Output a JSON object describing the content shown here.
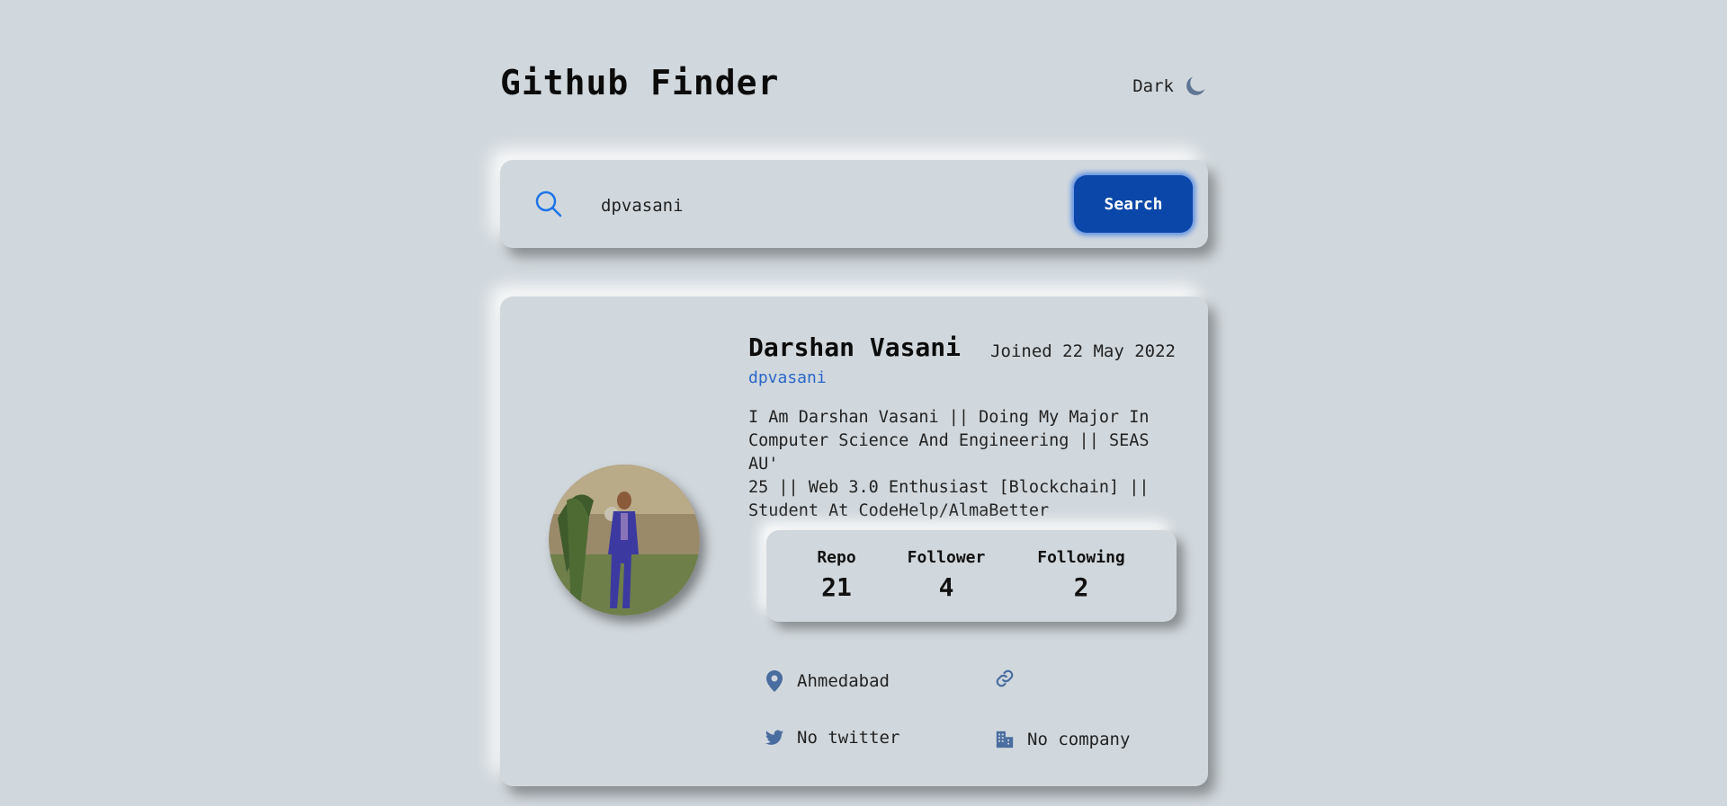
{
  "header": {
    "title": "Github Finder",
    "mode_label": "Dark",
    "mode_icon": "moon-icon"
  },
  "search": {
    "icon": "search-icon",
    "value": "dpvasani",
    "button_label": "Search"
  },
  "profile": {
    "name": "Darshan Vasani",
    "joined": "Joined 22 May 2022",
    "login": "dpvasani",
    "bio": "I Am Darshan Vasani || Doing My Major In\nComputer Science And Engineering || SEAS AU'\n25 || Web 3.0 Enthusiast [Blockchain] ||\nStudent At CodeHelp/AlmaBetter",
    "stats": {
      "repo_label": "Repo",
      "repo": "21",
      "follower_label": "Follower",
      "follower": "4",
      "following_label": "Following",
      "following": "2"
    },
    "links": {
      "location": "Ahmedabad",
      "website": "",
      "twitter": "No twitter",
      "company": "No company"
    }
  },
  "colors": {
    "background": "#d1d8dd",
    "accent": "#0b47a9",
    "icon": "#4a6da0",
    "link": "#2a66c8"
  }
}
